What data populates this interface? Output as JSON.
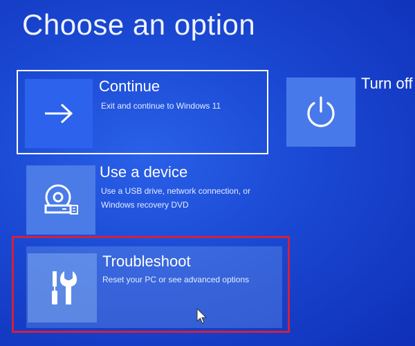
{
  "page": {
    "title": "Choose an option"
  },
  "options": {
    "continue": {
      "label": "Continue",
      "description": "Exit and continue to Windows 11",
      "icon": "arrow-right-icon"
    },
    "turn_off": {
      "label": "Turn off",
      "icon": "power-icon"
    },
    "use_device": {
      "label": "Use a device",
      "description_line1": "Use a USB drive, network connection, or",
      "description_line2": "Windows recovery DVD",
      "icon": "disc-drive-icon"
    },
    "troubleshoot": {
      "label": "Troubleshoot",
      "description": "Reset your PC or see advanced options",
      "icon": "tools-icon"
    }
  },
  "colors": {
    "background": "#1a48d2",
    "highlight_border": "#d2213c",
    "focus_border": "#ffffff"
  }
}
